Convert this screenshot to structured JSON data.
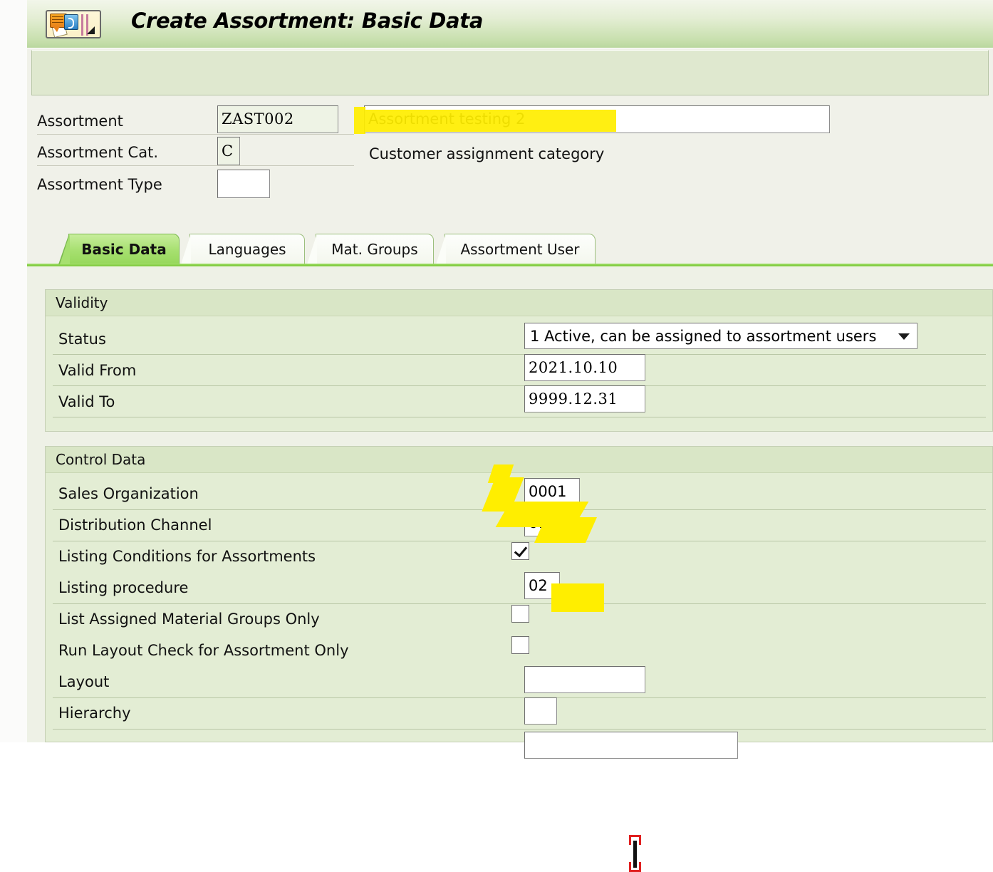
{
  "window": {
    "title": "Create Assortment: Basic Data",
    "app_icon": "assortment-app-icon"
  },
  "header_form": {
    "rows": [
      {
        "label": "Assortment",
        "value": "ZAST002",
        "description": "Assortment testing 2"
      },
      {
        "label": "Assortment Cat.",
        "value": "C",
        "description": "Customer assignment category"
      },
      {
        "label": "Assortment Type",
        "value": "",
        "description": ""
      }
    ]
  },
  "tabs": [
    {
      "label": "Basic Data",
      "active": true
    },
    {
      "label": "Languages",
      "active": false
    },
    {
      "label": "Mat. Groups",
      "active": false
    },
    {
      "label": "Assortment User",
      "active": false
    }
  ],
  "validity": {
    "section_title": "Validity",
    "status": {
      "label": "Status",
      "value": "1 Active, can be assigned to assortment users",
      "options": [
        "1 Active, can be assigned to assortment users"
      ]
    },
    "valid_from": {
      "label": "Valid From",
      "value": "2021.10.10"
    },
    "valid_to": {
      "label": "Valid To",
      "value": "9999.12.31"
    }
  },
  "control_data": {
    "section_title": "Control Data",
    "sales_organization": {
      "label": "Sales Organization",
      "value": "0001"
    },
    "distribution_channel": {
      "label": "Distribution Channel",
      "value": "01"
    },
    "listing_conditions": {
      "label": "Listing Conditions for Assortments",
      "checked": true
    },
    "listing_procedure": {
      "label": "Listing procedure",
      "value": "02"
    },
    "list_assigned_groups": {
      "label": "List Assigned Material Groups Only",
      "checked": false
    },
    "run_layout_check": {
      "label": "Run Layout Check for Assortment Only",
      "checked": false
    },
    "layout": {
      "label": "Layout",
      "value": ""
    },
    "hierarchy": {
      "label": "Hierarchy",
      "value": ""
    }
  },
  "annotations": {
    "highlight_color": "#ffee00",
    "cursor_marker_color": "#e02020",
    "marked_fields": [
      "assortment-description",
      "sales-organization-value",
      "distribution-channel-value",
      "listing-procedure-value"
    ]
  }
}
